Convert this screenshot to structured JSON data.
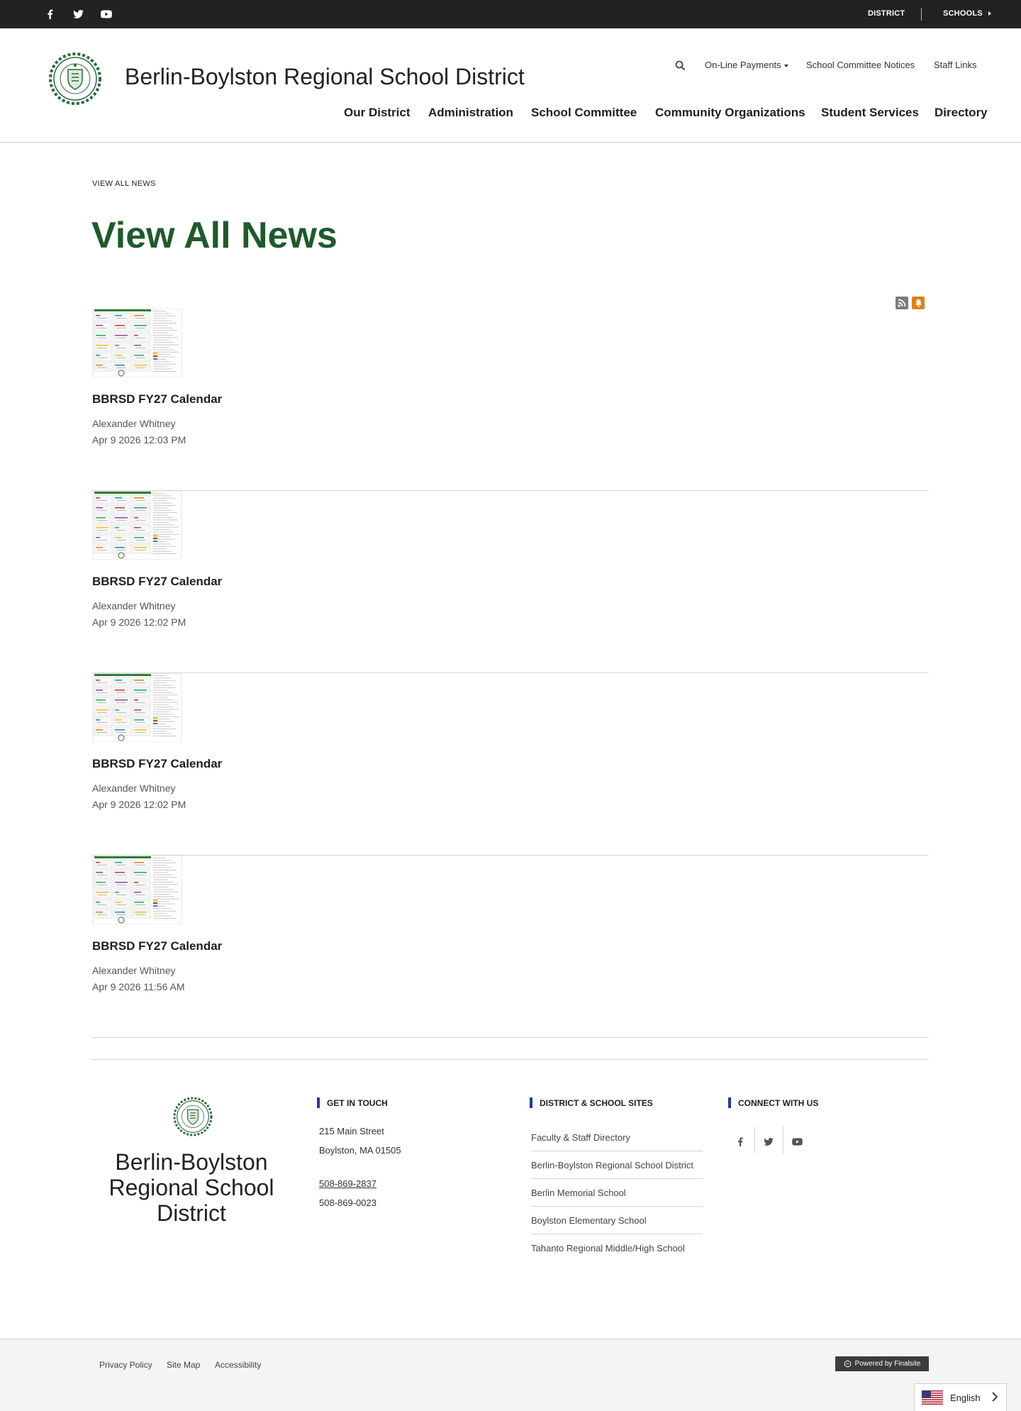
{
  "topbar": {
    "social_icons": [
      "facebook-icon",
      "twitter-icon",
      "youtube-icon"
    ],
    "district_label": "DISTRICT",
    "schools_label": "SCHOOLS"
  },
  "header": {
    "site_title": "Berlin-Boylston Regional School District",
    "quick_links": {
      "payments": "On-Line Payments",
      "committee_notices": "School Committee Notices",
      "staff_links": "Staff Links"
    },
    "nav": [
      "Our District",
      "Administration",
      "School Committee",
      "Community Organizations",
      "Student Services",
      "Directory"
    ]
  },
  "main": {
    "breadcrumb": "VIEW ALL NEWS",
    "title": "View All News",
    "news": [
      {
        "title": "BBRSD FY27 Calendar",
        "author": "Alexander Whitney",
        "date": "Apr 9 2026 12:03 PM"
      },
      {
        "title": "BBRSD FY27 Calendar",
        "author": "Alexander Whitney",
        "date": "Apr 9 2026 12:02 PM"
      },
      {
        "title": "BBRSD FY27 Calendar",
        "author": "Alexander Whitney",
        "date": "Apr 9 2026 12:02 PM"
      },
      {
        "title": "BBRSD FY27 Calendar",
        "author": "Alexander Whitney",
        "date": "Apr 9 2026 11:56 AM"
      }
    ]
  },
  "footer": {
    "name": "Berlin-Boylston Regional School District",
    "get_in_touch": {
      "heading": "GET IN TOUCH",
      "street": "215 Main Street",
      "city": "Boylston, MA  01505",
      "phone": "508-869-2837",
      "fax": "508-869-0023"
    },
    "sites": {
      "heading": "DISTRICT & SCHOOL SITES",
      "links": [
        "Faculty & Staff Directory",
        "Berlin-Boylston Regional School District",
        "Berlin Memorial School",
        "Boylston Elementary School",
        "Tahanto Regional Middle/High School"
      ]
    },
    "connect": {
      "heading": "CONNECT WITH US",
      "icons": [
        "facebook-icon",
        "twitter-icon",
        "youtube-icon"
      ]
    },
    "bottom_links": [
      "Privacy Policy",
      "Site Map",
      "Accessibility"
    ],
    "powered_by": "Powered by Finalsite",
    "language": "English"
  },
  "colors": {
    "title_green": "#1f5a2c",
    "topbar_bg": "#222222",
    "accent_blue": "#1f3aa6",
    "notify_orange": "#e3800f"
  }
}
